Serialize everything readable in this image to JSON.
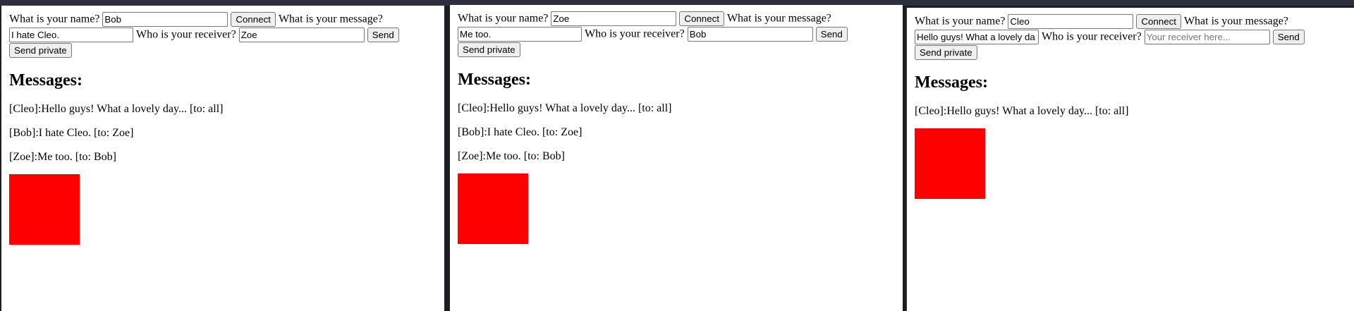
{
  "labels": {
    "name": "What is your name?",
    "message": "What is your message?",
    "receiver": "Who is your receiver?",
    "connect": "Connect",
    "send": "Send",
    "send_private": "Send private",
    "messages_heading": "Messages:",
    "receiver_placeholder": "Your receiver here..."
  },
  "windows": [
    {
      "name_value": "Bob",
      "message_value": "I hate Cleo.",
      "receiver_value": "Zoe",
      "messages": [
        "[Cleo]:Hello guys! What a lovely day... [to: all]",
        "[Bob]:I hate Cleo. [to: Zoe]",
        "[Zoe]:Me too. [to: Bob]"
      ]
    },
    {
      "name_value": "Zoe",
      "message_value": "Me too.",
      "receiver_value": "Bob",
      "messages": [
        "[Cleo]:Hello guys! What a lovely day... [to: all]",
        "[Bob]:I hate Cleo. [to: Zoe]",
        "[Zoe]:Me too. [to: Bob]"
      ]
    },
    {
      "name_value": "Cleo",
      "message_value": "Hello guys! What a lovely da",
      "receiver_value": "",
      "messages": [
        "[Cleo]:Hello guys! What a lovely day... [to: all]"
      ]
    }
  ],
  "colors": {
    "canvas_indicator": "#ff0000",
    "background": "#ffffff",
    "desktop": "#1c1c24"
  }
}
